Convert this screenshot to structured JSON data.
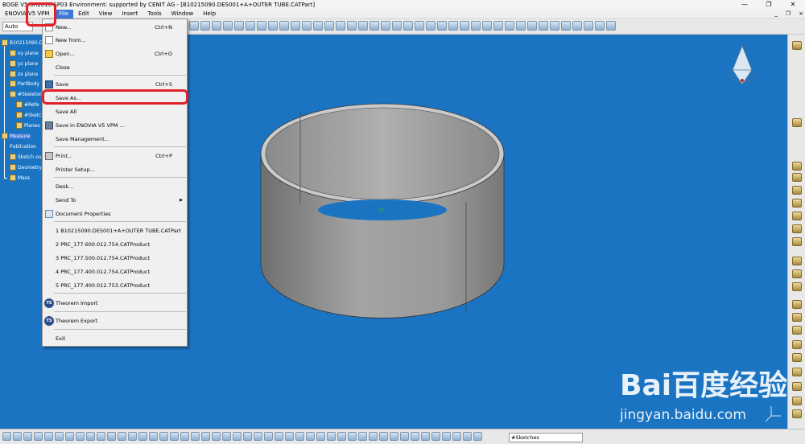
{
  "window": {
    "title": "BOGE V5-6R2016 SP03 Environment: supported by CENIT AG - [B10215090.DES001+A+OUTER TUBE.CATPart]",
    "controls": [
      "—",
      "❐",
      "✕"
    ]
  },
  "menubar": {
    "items": [
      "ENOVIA V5 VPM",
      "File",
      "Edit",
      "View",
      "Insert",
      "Tools",
      "Window",
      "Help"
    ],
    "active": "File",
    "mdi_controls": [
      "_",
      "❐",
      "×"
    ]
  },
  "toolbar": {
    "workbench_select": "Auto"
  },
  "tree": {
    "items": [
      {
        "label": "B10215090.DES"
      },
      {
        "label": "xy plane"
      },
      {
        "label": "yz plane"
      },
      {
        "label": "zx plane"
      },
      {
        "label": "PartBody"
      },
      {
        "label": "#Skeleton"
      },
      {
        "label": "#Refe"
      },
      {
        "label": "#Sketc"
      },
      {
        "label": "Planes"
      },
      {
        "label": "Measure"
      },
      {
        "label": "Publication"
      },
      {
        "label": "Sketch ou"
      },
      {
        "label": "Geometry o"
      },
      {
        "label": "Mass"
      }
    ]
  },
  "file_menu": {
    "items": [
      {
        "label": "New...",
        "shortcut": "Ctrl+N"
      },
      {
        "label": "New from...",
        "shortcut": ""
      },
      {
        "label": "Open...",
        "shortcut": "Ctrl+O"
      },
      {
        "label": "Close",
        "shortcut": ""
      },
      {
        "label": "Save",
        "shortcut": "Ctrl+S"
      },
      {
        "label": "Save As...",
        "shortcut": ""
      },
      {
        "label": "Save All",
        "shortcut": ""
      },
      {
        "label": "Save in ENOVIA V5 VPM ...",
        "shortcut": ""
      },
      {
        "label": "Save Management...",
        "shortcut": ""
      },
      {
        "label": "Print...",
        "shortcut": "Ctrl+P"
      },
      {
        "label": "Printer Setup...",
        "shortcut": ""
      },
      {
        "label": "Desk...",
        "shortcut": ""
      },
      {
        "label": "Send To",
        "shortcut": ""
      },
      {
        "label": "Document Properties",
        "shortcut": ""
      },
      {
        "label": "1 B10215090.DES001+A+OUTER TUBE.CATPart",
        "shortcut": ""
      },
      {
        "label": "2 PRC_177.600.012.754.CATProduct",
        "shortcut": ""
      },
      {
        "label": "3 PRC_177.500.012.754.CATProduct",
        "shortcut": ""
      },
      {
        "label": "4 PRC_177.400.012.754.CATProduct",
        "shortcut": ""
      },
      {
        "label": "5 PRC_177.400.012.753.CATProduct",
        "shortcut": ""
      },
      {
        "label": "Theorem Import",
        "shortcut": ""
      },
      {
        "label": "Theorem Export",
        "shortcut": ""
      },
      {
        "label": "Exit",
        "shortcut": ""
      }
    ],
    "highlighted": "Save As...",
    "send_to_arrow": "▶",
    "ts_icon_text": "TS"
  },
  "bottombar": {
    "sketch_select": "#Sketches"
  },
  "watermark": {
    "logo": "Bai百度经验",
    "url": "jingyan.baidu.com"
  },
  "colors": {
    "viewport_bg": "#1b74c2",
    "highlight_red": "#e3202a",
    "menu_active": "#3b78d8",
    "tube_gray": "#9b9b9b"
  }
}
